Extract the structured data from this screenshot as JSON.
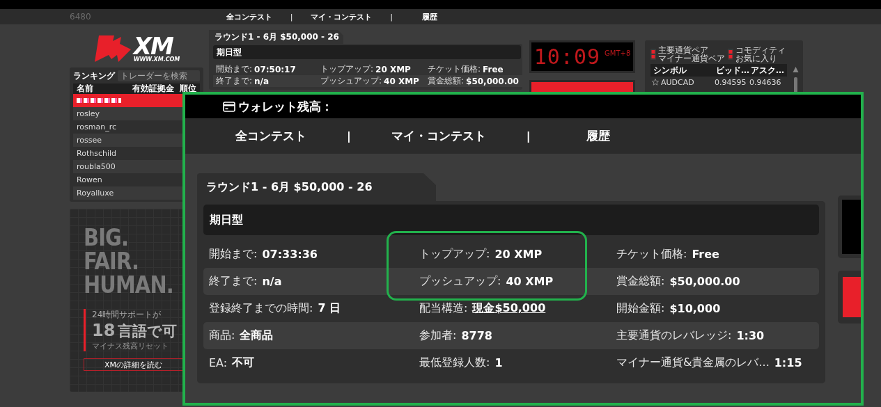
{
  "top_nav": {
    "counter": "6480",
    "items": [
      {
        "kind": "tab",
        "label": "全コンテスト"
      },
      {
        "kind": "separator",
        "label": "|"
      },
      {
        "kind": "tab",
        "label": "マイ・コンテスト"
      },
      {
        "kind": "separator",
        "label": "|"
      },
      {
        "kind": "tab",
        "label": "履歴"
      }
    ]
  },
  "logo": {
    "wordmark": "XM",
    "url": "WWW.XM.COM"
  },
  "ranking": {
    "title": "ランキング",
    "search": {
      "placeholder": "トレーダーを検索"
    },
    "columns": [
      "名前",
      "有効証拠金",
      "順位"
    ],
    "rows": [
      {
        "selected": true,
        "redacted": true
      },
      {
        "name": "rosley",
        "selected": false,
        "redacted": false
      },
      {
        "name": "rosman_rc",
        "selected": false,
        "redacted": false
      },
      {
        "name": "rossee",
        "selected": false,
        "redacted": false
      },
      {
        "name": "Rothschild",
        "selected": false,
        "redacted": false
      },
      {
        "name": "roubla500",
        "selected": false,
        "redacted": false
      },
      {
        "name": "Rowen",
        "selected": false,
        "redacted": false
      },
      {
        "name": "Royalluxe",
        "selected": false,
        "redacted": false
      }
    ]
  },
  "ad": {
    "headline": [
      "BIG.",
      "FAIR.",
      "HUMAN."
    ],
    "support_label": "24時間サポートが",
    "big_number": "18",
    "big_text": "言語で可",
    "note": "マイナス残高リセット",
    "button": "XMの詳細を読む"
  },
  "contest_preview": {
    "title": "ラウンド1 - 6月 $50,000 - 26",
    "type": "期日型",
    "fields": [
      {
        "label": "開始まで:",
        "value": "07:50:17"
      },
      {
        "label": "トップアップ:",
        "value": "20 XMP"
      },
      {
        "label": "チケット価格:",
        "value": "Free"
      },
      {
        "label": "終了まで:",
        "value": "n/a"
      },
      {
        "label": "プッシュアップ:",
        "value": "40 XMP"
      },
      {
        "label": "賞金総額:",
        "value": "$50,000.00"
      }
    ]
  },
  "clock": {
    "time": "10:09",
    "zone": "GMT+8"
  },
  "quotes": {
    "tabs": [
      {
        "lines": [
          "主要通貨ペア",
          "マイナー通貨ペア"
        ]
      },
      {
        "lines": [
          "コモディティ",
          "お気に入り"
        ]
      }
    ],
    "columns": [
      "シンボル",
      "ビッド…",
      "アスク…"
    ],
    "rows": [
      {
        "favorite": false,
        "symbol": "AUDCAD",
        "bid": "0.94595",
        "ask": "0.94636"
      }
    ]
  },
  "inset": {
    "wallet_label": "ウォレット残高：",
    "nav": [
      {
        "kind": "tab",
        "label": "全コンテスト"
      },
      {
        "kind": "separator",
        "label": "|"
      },
      {
        "kind": "tab",
        "label": "マイ・コンテスト"
      },
      {
        "kind": "separator",
        "label": "|"
      },
      {
        "kind": "tab",
        "label": "履歴"
      }
    ],
    "contest": {
      "title": "ラウンド1 - 6月 $50,000 - 26",
      "type": "期日型",
      "fields": [
        {
          "label": "開始まで:",
          "value": "07:33:36",
          "link": false
        },
        {
          "label": "トップアップ:",
          "value": "20 XMP",
          "link": false
        },
        {
          "label": "チケット価格:",
          "value": "Free",
          "link": false
        },
        {
          "label": "終了まで:",
          "value": "n/a",
          "link": false
        },
        {
          "label": "プッシュアップ:",
          "value": "40 XMP",
          "link": false
        },
        {
          "label": "賞金総額:",
          "value": "$50,000.00",
          "link": false
        },
        {
          "label": "登録終了までの時間:",
          "value": "7 日",
          "link": false
        },
        {
          "label": "配当構造:",
          "value": "現金$50,000",
          "link": true
        },
        {
          "label": "開始金額:",
          "value": "$10,000",
          "link": false
        },
        {
          "label": "商品:",
          "value": "全商品",
          "link": false
        },
        {
          "label": "参加者:",
          "value": "8778",
          "link": false
        },
        {
          "label": "主要通貨のレバレッジ:",
          "value": "1:30",
          "link": false
        },
        {
          "label": "EA:",
          "value": "不可",
          "link": false
        },
        {
          "label": "最低登録人数:",
          "value": "1",
          "link": false
        },
        {
          "label": "マイナー通貨&貴金属のレバ...",
          "value": "1:15",
          "link": false
        }
      ]
    }
  }
}
